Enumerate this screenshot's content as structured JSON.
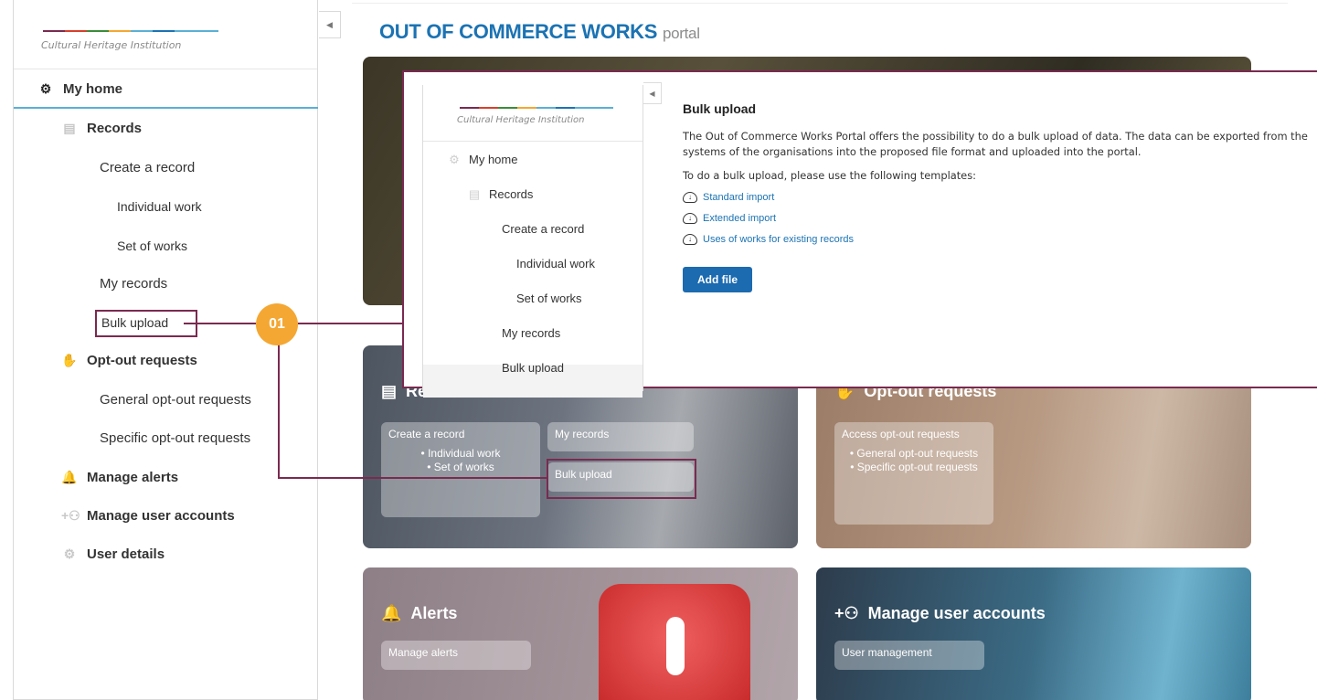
{
  "brand": {
    "logo_text": "Cultural Heritage Institution",
    "logo_colors": [
      "#7a2a50",
      "#d7402b",
      "#3c8c3a",
      "#f4a732",
      "#5ab0d6",
      "#1b73b3"
    ]
  },
  "sidebar": {
    "home": "My home",
    "records": "Records",
    "create_record": "Create a record",
    "individual_work": "Individual work",
    "set_of_works": "Set of works",
    "my_records": "My records",
    "bulk_upload": "Bulk upload",
    "opt_out": "Opt-out requests",
    "general_opt_out": "General opt-out requests",
    "specific_opt_out": "Specific opt-out requests",
    "manage_alerts": "Manage alerts",
    "manage_users": "Manage user accounts",
    "user_details": "User details"
  },
  "main": {
    "title": "OUT OF COMMERCE WORKS",
    "title_suffix": "portal",
    "records_tile": {
      "title": "Records",
      "create": "Create a record",
      "create_items": [
        "Individual work",
        "Set of works"
      ],
      "my_records": "My records",
      "bulk": "Bulk upload"
    },
    "optout_tile": {
      "title": "Opt-out requests",
      "access": "Access opt-out requests",
      "items": [
        "General opt-out requests",
        "Specific opt-out requests"
      ]
    },
    "alerts_tile": {
      "title": "Alerts",
      "manage": "Manage alerts"
    },
    "users_tile": {
      "title": "Manage user accounts",
      "manage": "User management"
    }
  },
  "popup": {
    "heading": "Bulk upload",
    "paragraph": "The Out of Commerce Works Portal offers the possibility to do a bulk upload of data. The data can be exported from the systems of the organisations into the proposed file format and uploaded into the portal.",
    "templates_intro": "To do a bulk upload, please use the following templates:",
    "links": [
      "Standard import",
      "Extended import",
      "Uses of works for existing records"
    ],
    "add_file": "Add file"
  },
  "callout": {
    "number": "01",
    "color": "#f4a732",
    "line_color": "#7a2a50"
  }
}
